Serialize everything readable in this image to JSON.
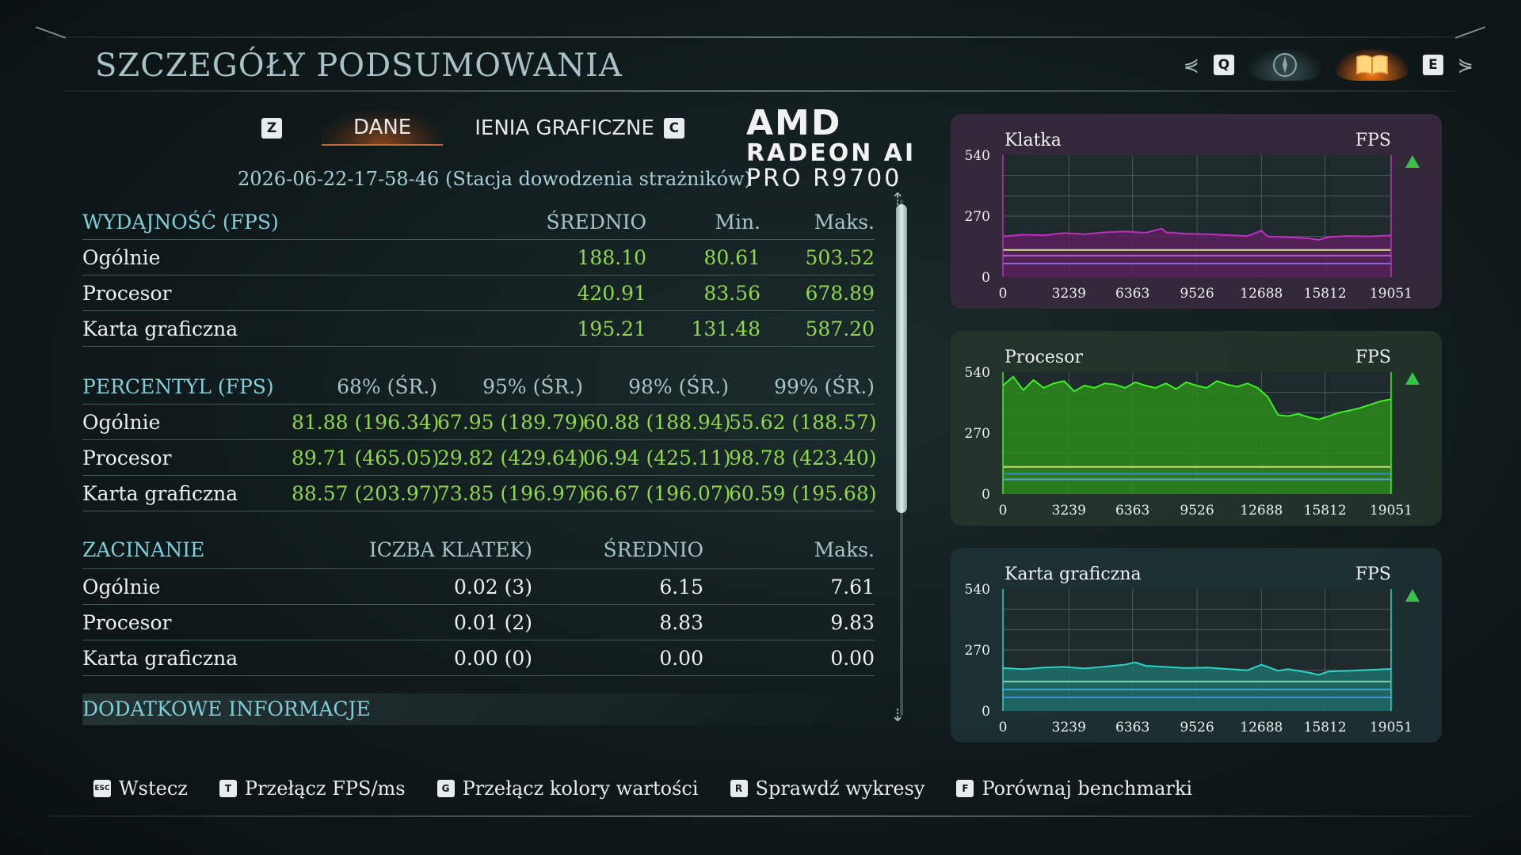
{
  "header": {
    "title": "SZCZEGÓŁY PODSUMOWANIA",
    "key_q": "Q",
    "key_e": "E",
    "arrow_left": "⋞",
    "arrow_right": "⋟"
  },
  "tabs": {
    "key_z": "Z",
    "key_c": "C",
    "items": [
      {
        "label": "DANE"
      },
      {
        "label": "IENIA GRAFICZNE"
      }
    ]
  },
  "timestamp": "2026-06-22-17-58-46 (Stacja dowodzenia strażników)",
  "gpu_logo": {
    "line1": "AMD",
    "line2": "RADEON AI",
    "line3": "PRO R9700"
  },
  "performance": {
    "title": "WYDAJNOŚĆ (FPS)",
    "columns": [
      "ŚREDNIO",
      "Min.",
      "Maks."
    ],
    "rows": [
      {
        "label": "Ogólnie",
        "values": [
          "188.10",
          "80.61",
          "503.52"
        ]
      },
      {
        "label": "Procesor",
        "values": [
          "420.91",
          "83.56",
          "678.89"
        ]
      },
      {
        "label": "Karta graficzna",
        "values": [
          "195.21",
          "131.48",
          "587.20"
        ]
      }
    ]
  },
  "percentile": {
    "title": "PERCENTYL (FPS)",
    "columns": [
      "68% (ŚR.)",
      "95% (ŚR.)",
      "98% (ŚR.)",
      "99% (ŚR.)"
    ],
    "rows": [
      {
        "label": "Ogólnie",
        "values": [
          "81.88 (196.34)",
          "67.95 (189.79)",
          "60.88 (188.94)",
          "55.62 (188.57)"
        ]
      },
      {
        "label": "Procesor",
        "values": [
          "89.71 (465.05)",
          "29.82 (429.64)",
          "06.94 (425.11)",
          "98.78 (423.40)"
        ]
      },
      {
        "label": "Karta graficzna",
        "values": [
          "88.57 (203.97)",
          "73.85 (196.97)",
          "66.67 (196.07)",
          "60.59 (195.68)"
        ]
      }
    ]
  },
  "stutter": {
    "title": "ZACINANIE",
    "columns": [
      "ICZBA KLATEK)",
      "ŚREDNIO",
      "Maks."
    ],
    "rows": [
      {
        "label": "Ogólnie",
        "values": [
          "0.02 (3)",
          "6.15",
          "7.61"
        ]
      },
      {
        "label": "Procesor",
        "values": [
          "0.01 (2)",
          "8.83",
          "9.83"
        ]
      },
      {
        "label": "Karta graficzna",
        "values": [
          "0.00 (0)",
          "0.00",
          "0.00"
        ]
      }
    ]
  },
  "additional": {
    "title": "DODATKOWE INFORMACJE"
  },
  "scroll": {
    "up": "⇡",
    "down": "⇣"
  },
  "chart_data": [
    {
      "type": "line",
      "title": "Klatka",
      "ylabel": "FPS",
      "color": "#c22ec2",
      "fill": "#5a1f5c",
      "bg": "#3a2a40",
      "y_ticks": [
        0,
        270,
        540
      ],
      "x_ticks": [
        0,
        3239,
        6363,
        9526,
        12688,
        15812,
        19051
      ],
      "ylim": [
        0,
        540
      ],
      "xlim": [
        0,
        19051
      ],
      "x": [
        0,
        1000,
        2000,
        3000,
        4000,
        5000,
        6000,
        7000,
        7800,
        8000,
        9000,
        10000,
        11000,
        12000,
        12688,
        13000,
        14000,
        15000,
        15500,
        16000,
        17000,
        18000,
        19051
      ],
      "y": [
        180,
        188,
        185,
        195,
        190,
        198,
        202,
        196,
        215,
        198,
        192,
        190,
        186,
        182,
        205,
        180,
        176,
        172,
        165,
        178,
        182,
        180,
        185
      ],
      "guides": [
        {
          "value": 120,
          "color": "#d6e38a"
        },
        {
          "value": 95,
          "color": "#b05cc8"
        },
        {
          "value": 60,
          "color": "#8e66d8"
        }
      ]
    },
    {
      "type": "line",
      "title": "Procesor",
      "ylabel": "FPS",
      "color": "#3ef022",
      "fill": "#2c8a1c",
      "bg": "#24362a",
      "y_ticks": [
        0,
        270,
        540
      ],
      "x_ticks": [
        0,
        3239,
        6363,
        9526,
        12688,
        15812,
        19051
      ],
      "ylim": [
        0,
        540
      ],
      "xlim": [
        0,
        19051
      ],
      "x": [
        0,
        500,
        1000,
        1500,
        2000,
        2500,
        3000,
        3500,
        4000,
        4500,
        5000,
        5500,
        6000,
        6500,
        7000,
        7500,
        8000,
        8500,
        9000,
        9500,
        10000,
        10500,
        11000,
        11500,
        12000,
        12500,
        13000,
        13500,
        14000,
        14500,
        15000,
        15500,
        16000,
        16500,
        17000,
        17500,
        18000,
        18500,
        19051
      ],
      "y": [
        480,
        520,
        460,
        505,
        470,
        490,
        500,
        455,
        480,
        470,
        490,
        485,
        470,
        495,
        480,
        470,
        490,
        465,
        495,
        480,
        470,
        500,
        485,
        475,
        490,
        470,
        430,
        350,
        345,
        355,
        340,
        330,
        345,
        360,
        370,
        380,
        395,
        410,
        420
      ],
      "guides": [
        {
          "value": 120,
          "color": "#c9dc6a"
        },
        {
          "value": 90,
          "color": "#2d8dd0"
        },
        {
          "value": 65,
          "color": "#5aa0d8"
        }
      ]
    },
    {
      "type": "line",
      "title": "Karta graficzna",
      "ylabel": "FPS",
      "color": "#2ad3c8",
      "fill": "#1d6e6a",
      "bg": "#1e3236",
      "y_ticks": [
        0,
        270,
        540
      ],
      "x_ticks": [
        0,
        3239,
        6363,
        9526,
        12688,
        15812,
        19051
      ],
      "ylim": [
        0,
        540
      ],
      "xlim": [
        0,
        19051
      ],
      "x": [
        0,
        1000,
        2000,
        3000,
        4000,
        5000,
        6000,
        6500,
        7000,
        8000,
        9000,
        10000,
        11000,
        12000,
        12688,
        13500,
        14000,
        15000,
        15500,
        16000,
        17000,
        18000,
        19051
      ],
      "y": [
        190,
        185,
        192,
        195,
        188,
        196,
        205,
        215,
        200,
        195,
        190,
        192,
        186,
        180,
        205,
        178,
        185,
        170,
        160,
        175,
        178,
        182,
        186
      ],
      "guides": [
        {
          "value": 130,
          "color": "#7ed8a8"
        },
        {
          "value": 95,
          "color": "#2da8d8"
        },
        {
          "value": 60,
          "color": "#4a90d0"
        }
      ]
    }
  ],
  "footer": {
    "items": [
      {
        "key": "ESC",
        "label": "Wstecz"
      },
      {
        "key": "T",
        "label": "Przełącz FPS/ms"
      },
      {
        "key": "G",
        "label": "Przełącz kolory wartości"
      },
      {
        "key": "R",
        "label": "Sprawdź wykresy"
      },
      {
        "key": "F",
        "label": "Porównaj benchmarki"
      }
    ]
  }
}
